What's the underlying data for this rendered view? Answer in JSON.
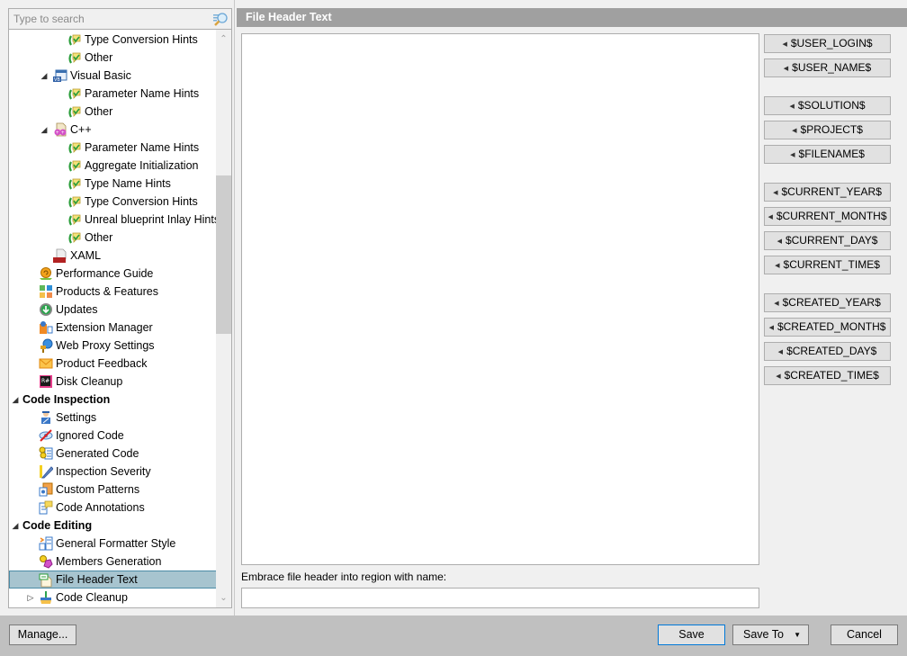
{
  "search": {
    "placeholder": "Type to search",
    "value": ""
  },
  "tree": {
    "rows": [
      {
        "label": "Type Conversion Hints",
        "indent": 4,
        "icon": "inlay-hints-icon",
        "expander": ""
      },
      {
        "label": "Other",
        "indent": 4,
        "icon": "inlay-hints-icon",
        "expander": ""
      },
      {
        "label": "Visual Basic",
        "indent": 3,
        "icon": "visual-basic-icon",
        "expander": "expanded"
      },
      {
        "label": "Parameter Name Hints",
        "indent": 4,
        "icon": "inlay-hints-icon",
        "expander": ""
      },
      {
        "label": "Other",
        "indent": 4,
        "icon": "inlay-hints-icon",
        "expander": ""
      },
      {
        "label": "C++",
        "indent": 3,
        "icon": "cpp-icon",
        "expander": "expanded"
      },
      {
        "label": "Parameter Name Hints",
        "indent": 4,
        "icon": "inlay-hints-icon",
        "expander": ""
      },
      {
        "label": "Aggregate Initialization",
        "indent": 4,
        "icon": "inlay-hints-icon",
        "expander": ""
      },
      {
        "label": "Type Name Hints",
        "indent": 4,
        "icon": "inlay-hints-icon",
        "expander": ""
      },
      {
        "label": "Type Conversion Hints",
        "indent": 4,
        "icon": "inlay-hints-icon",
        "expander": ""
      },
      {
        "label": "Unreal blueprint Inlay Hints",
        "indent": 4,
        "icon": "inlay-hints-icon",
        "expander": ""
      },
      {
        "label": "Other",
        "indent": 4,
        "icon": "inlay-hints-icon",
        "expander": ""
      },
      {
        "label": "XAML",
        "indent": 3,
        "icon": "xaml-icon",
        "expander": ""
      },
      {
        "label": "Performance Guide",
        "indent": 2,
        "icon": "snail-icon",
        "expander": ""
      },
      {
        "label": "Products & Features",
        "indent": 2,
        "icon": "products-icon",
        "expander": ""
      },
      {
        "label": "Updates",
        "indent": 2,
        "icon": "download-icon",
        "expander": ""
      },
      {
        "label": "Extension Manager",
        "indent": 2,
        "icon": "extension-icon",
        "expander": ""
      },
      {
        "label": "Web Proxy Settings",
        "indent": 2,
        "icon": "globe-plug-icon",
        "expander": ""
      },
      {
        "label": "Product Feedback",
        "indent": 2,
        "icon": "envelope-icon",
        "expander": ""
      },
      {
        "label": "Disk Cleanup",
        "indent": 2,
        "icon": "resharper-icon",
        "expander": ""
      },
      {
        "label": "Code Inspection",
        "indent": 0,
        "icon": "",
        "expander": "expanded",
        "header": true
      },
      {
        "label": "Settings",
        "indent": 2,
        "icon": "inspector-icon",
        "expander": ""
      },
      {
        "label": "Ignored Code",
        "indent": 2,
        "icon": "eye-crossed-icon",
        "expander": ""
      },
      {
        "label": "Generated Code",
        "indent": 2,
        "icon": "generated-code-icon",
        "expander": ""
      },
      {
        "label": "Inspection Severity",
        "indent": 2,
        "icon": "severity-icon",
        "expander": ""
      },
      {
        "label": "Custom Patterns",
        "indent": 2,
        "icon": "patterns-icon",
        "expander": ""
      },
      {
        "label": "Code Annotations",
        "indent": 2,
        "icon": "annotations-icon",
        "expander": ""
      },
      {
        "label": "Code Editing",
        "indent": 0,
        "icon": "",
        "expander": "expanded",
        "header": true
      },
      {
        "label": "General Formatter Style",
        "indent": 2,
        "icon": "formatter-icon",
        "expander": ""
      },
      {
        "label": "Members Generation",
        "indent": 2,
        "icon": "members-icon",
        "expander": ""
      },
      {
        "label": "File Header Text",
        "indent": 2,
        "icon": "file-header-icon",
        "expander": "",
        "selected": true
      },
      {
        "label": "Code Cleanup",
        "indent": 2,
        "icon": "broom-icon",
        "expander": "collapsed"
      }
    ]
  },
  "page": {
    "title": "File Header Text",
    "editor_value": "",
    "region_label": "Embrace file header into region with name:",
    "region_value": ""
  },
  "macros": [
    {
      "label": "$USER_LOGIN$",
      "group": 0
    },
    {
      "label": "$USER_NAME$",
      "group": 0
    },
    {
      "label": "$SOLUTION$",
      "group": 1
    },
    {
      "label": "$PROJECT$",
      "group": 1
    },
    {
      "label": "$FILENAME$",
      "group": 1
    },
    {
      "label": "$CURRENT_YEAR$",
      "group": 2
    },
    {
      "label": "$CURRENT_MONTH$",
      "group": 2
    },
    {
      "label": "$CURRENT_DAY$",
      "group": 2
    },
    {
      "label": "$CURRENT_TIME$",
      "group": 2
    },
    {
      "label": "$CREATED_YEAR$",
      "group": 3
    },
    {
      "label": "$CREATED_MONTH$",
      "group": 3
    },
    {
      "label": "$CREATED_DAY$",
      "group": 3
    },
    {
      "label": "$CREATED_TIME$",
      "group": 3
    }
  ],
  "footer": {
    "manage": "Manage...",
    "save": "Save",
    "save_to": "Save To",
    "cancel": "Cancel"
  }
}
